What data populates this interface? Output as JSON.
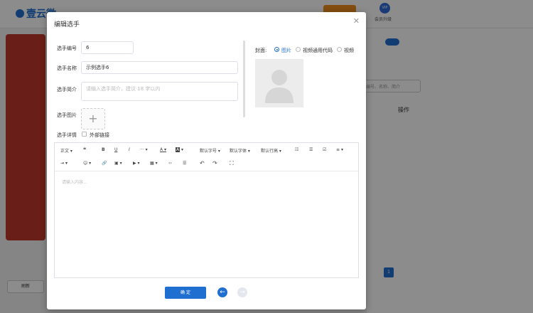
{
  "app": {
    "brand": "壹云微",
    "vip_label": "会员升级",
    "vip_badge": "VIP"
  },
  "background": {
    "search_placeholder": "编号、名称、简介",
    "ops_header": "操作",
    "page_number": "1",
    "refresh_label": "刷新"
  },
  "modal": {
    "title": "编辑选手",
    "close_icon": "close-icon",
    "fields": {
      "number_label": "选手编号",
      "number_value": "6",
      "name_label": "选手名称",
      "name_value": "示例选手6",
      "intro_label": "选手简介",
      "intro_placeholder": "请输入选手简介，建议 18 字以内",
      "image_label": "选手图片",
      "detail_label": "选手详情",
      "external_link_label": "外部链接"
    },
    "cover": {
      "label": "封面:",
      "options": [
        "图片",
        "视频通用代码",
        "视频"
      ],
      "selected": "图片"
    },
    "editor": {
      "toolbar": {
        "paragraph": "正文",
        "quote": "❝",
        "bold": "B",
        "underline": "U",
        "italic": "I",
        "more": "···",
        "font_color": "A",
        "bg_color": "A",
        "font_size": "默认字号",
        "font_family": "默认字体",
        "line_height": "默认行高",
        "ul": "☷",
        "ol": "☰",
        "todo": "☑",
        "align": "≡",
        "indent": "⇥",
        "emoji": "☺",
        "link": "🔗",
        "image": "▣",
        "video": "▶",
        "table": "▦",
        "code": "‹›",
        "divider": "☰",
        "undo": "↶",
        "redo": "↷",
        "fullscreen": "⛶"
      },
      "placeholder": "请输入内容..."
    },
    "confirm_label": "确 定"
  },
  "colors": {
    "primary": "#1f6fd1",
    "accent": "#f08c1d",
    "brand_red": "#c0392b"
  }
}
